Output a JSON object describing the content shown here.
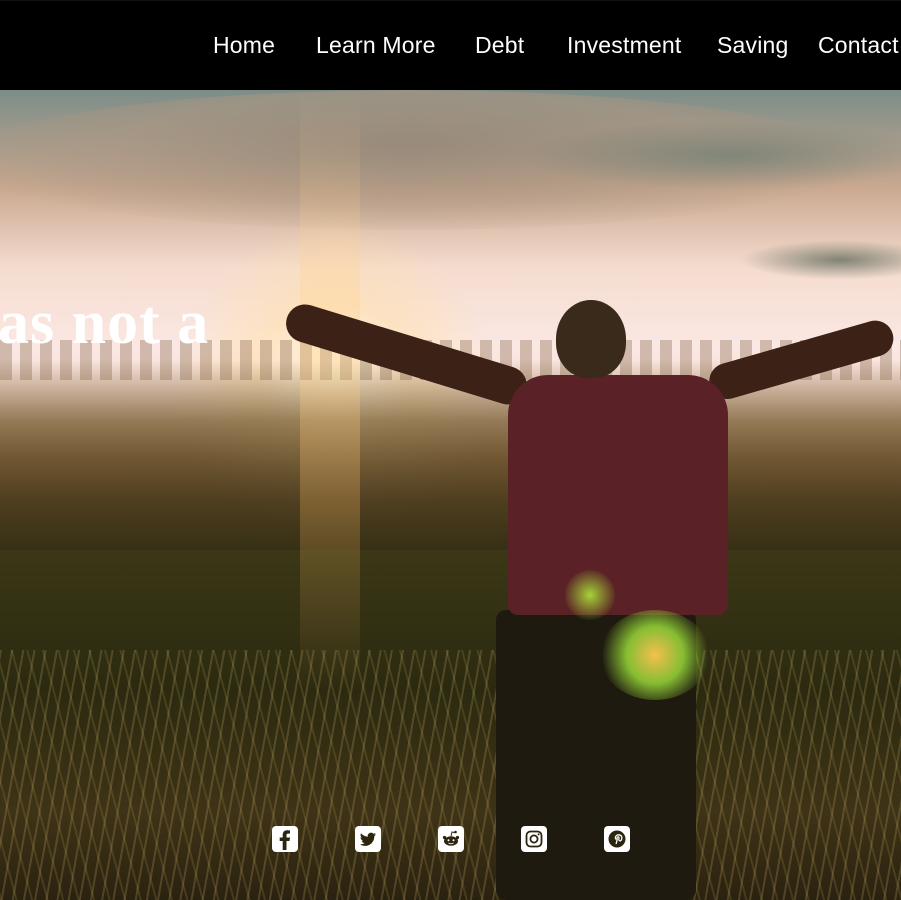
{
  "nav": {
    "items": [
      {
        "label": "Home"
      },
      {
        "label": "Learn More"
      },
      {
        "label": "Debt"
      },
      {
        "label": "Investment"
      },
      {
        "label": "Saving"
      },
      {
        "label": "Contact"
      }
    ]
  },
  "hero": {
    "headline": "as not a"
  },
  "social": {
    "icons": [
      "facebook-icon",
      "twitter-icon",
      "reddit-icon",
      "instagram-icon",
      "pinterest-icon"
    ]
  },
  "colors": {
    "topbar": "#000000",
    "nav_text": "#ffffff",
    "icon_bg": "#ffffff"
  }
}
